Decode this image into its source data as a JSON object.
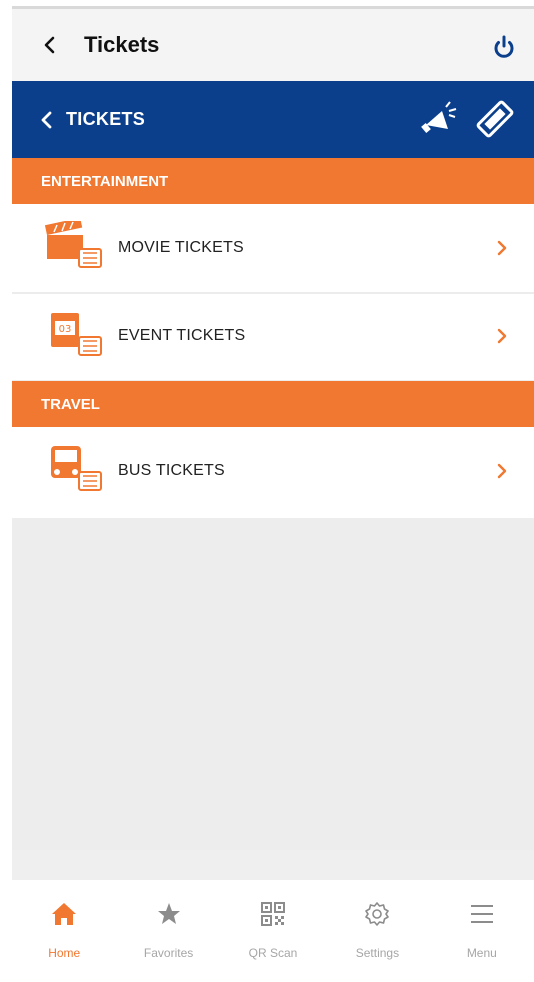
{
  "header": {
    "title": "Tickets"
  },
  "subheader": {
    "title": "TICKETS"
  },
  "sections": [
    {
      "title": "ENTERTAINMENT",
      "items": [
        {
          "label": "MOVIE TICKETS"
        },
        {
          "label": "EVENT TICKETS",
          "calendar_day": "03"
        }
      ]
    },
    {
      "title": "TRAVEL",
      "items": [
        {
          "label": "BUS TICKETS"
        }
      ]
    }
  ],
  "tabs": [
    {
      "label": "Home",
      "icon": "home-icon",
      "active": true
    },
    {
      "label": "Favorites",
      "icon": "star-icon"
    },
    {
      "label": "QR Scan",
      "icon": "qr-icon"
    },
    {
      "label": "Settings",
      "icon": "gear-icon"
    },
    {
      "label": "Menu",
      "icon": "menu-icon"
    }
  ],
  "colors": {
    "brand_blue": "#0b3f8c",
    "accent_orange": "#f07830",
    "power_blue": "#0b3f8c"
  }
}
